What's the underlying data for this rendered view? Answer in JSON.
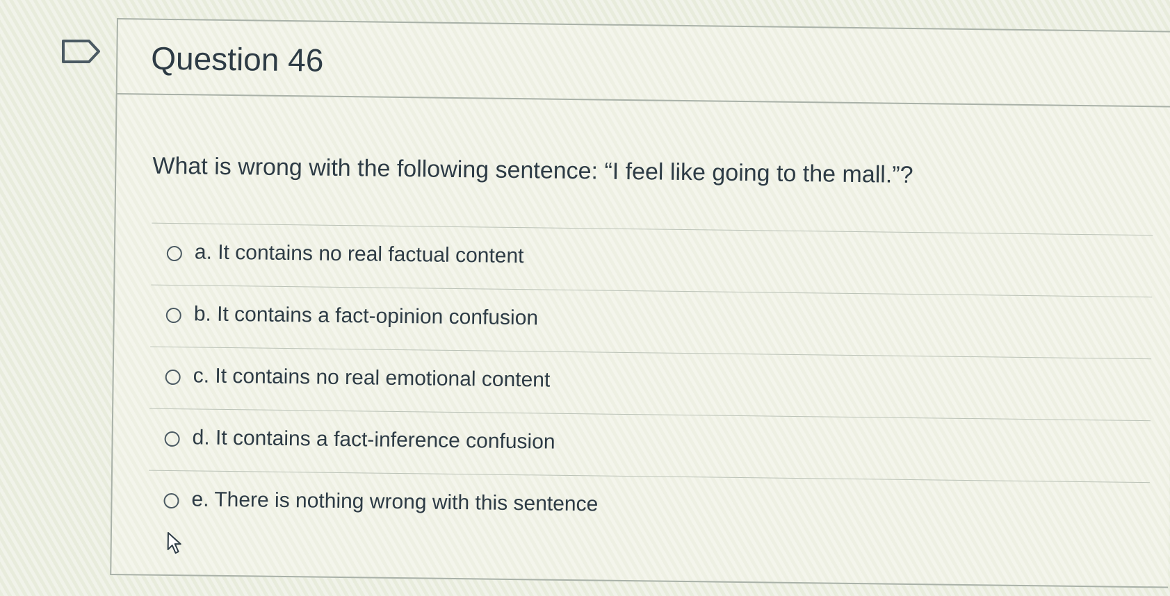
{
  "question": {
    "title": "Question 46",
    "text": "What is wrong with the following sentence: “I feel like going to the mall.”?"
  },
  "answers": [
    {
      "label": "a. It contains no real factual content",
      "selected": false
    },
    {
      "label": "b. It contains a fact-opinion confusion",
      "selected": false
    },
    {
      "label": "c. It contains no real emotional content",
      "selected": false
    },
    {
      "label": "d. It contains a fact-inference confusion",
      "selected": false
    },
    {
      "label": "e. There is nothing wrong with this sentence",
      "selected": false
    }
  ],
  "icons": {
    "flag": "flag-question-icon",
    "cursor": "mouse-pointer-icon"
  },
  "colors": {
    "text": "#2d3b45",
    "border": "#a9b1a8",
    "radio": "#4b5a63"
  }
}
